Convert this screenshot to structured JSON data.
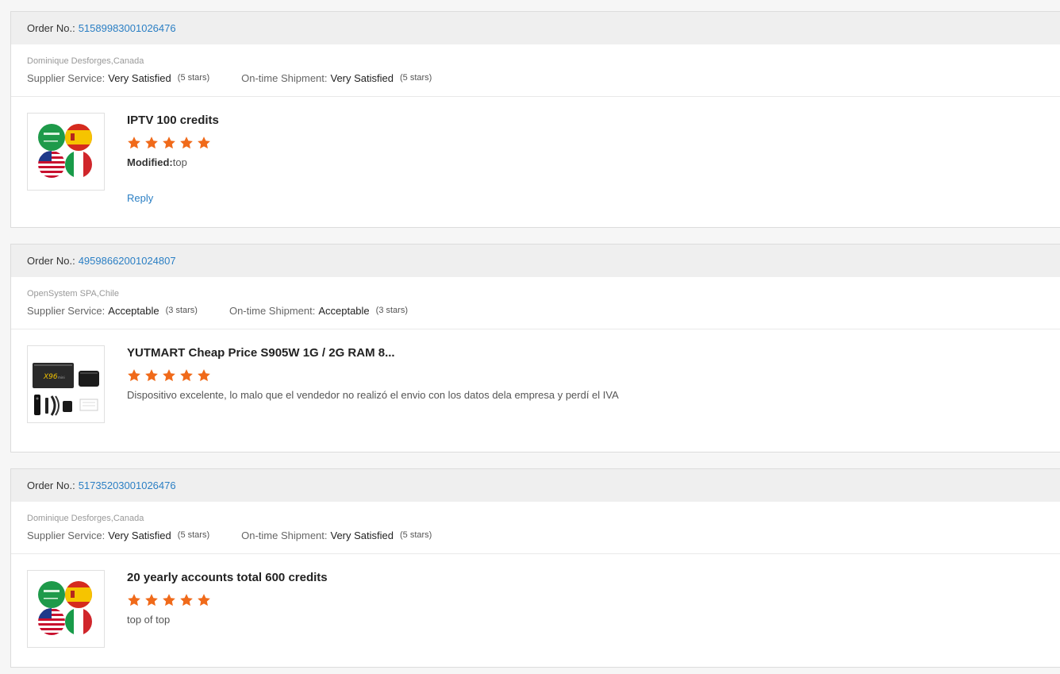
{
  "labels": {
    "order_no": "Order No.:",
    "supplier_service": "Supplier Service:",
    "ontime_shipment": "On-time Shipment:",
    "reply": "Reply"
  },
  "colors": {
    "link": "#2b7fc4",
    "star": "#f06a1a",
    "header_bg": "#efefef"
  },
  "reviews": [
    {
      "order_number": "51589983001026476",
      "buyer": "Dominique Desforges,Canada",
      "supplier_rating": "Very Satisfied",
      "supplier_stars": "(5 stars)",
      "shipment_rating": "Very Satisfied",
      "shipment_stars": "(5 stars)",
      "product_title": "IPTV 100 credits",
      "product_image": "flags-icon",
      "star_count": 5,
      "review_prefix": "Modified:",
      "review_text": "top",
      "reply": "Reply"
    },
    {
      "order_number": "49598662001024807",
      "buyer": "OpenSystem SPA,Chile",
      "supplier_rating": "Acceptable",
      "supplier_stars": "(3 stars)",
      "shipment_rating": "Acceptable",
      "shipment_stars": "(3 stars)",
      "product_title": "YUTMART Cheap Price S905W 1G / 2G RAM 8...",
      "product_image": "tv-box-icon",
      "star_count": 5,
      "review_text": "Dispositivo excelente, lo malo que el vendedor no realizó el envio con los datos dela empresa y perdí el IVA"
    },
    {
      "order_number": "51735203001026476",
      "buyer": "Dominique Desforges,Canada",
      "supplier_rating": "Very Satisfied",
      "supplier_stars": "(5 stars)",
      "shipment_rating": "Very Satisfied",
      "shipment_stars": "(5 stars)",
      "product_title": "20 yearly accounts total 600 credits",
      "product_image": "flags-icon",
      "star_count": 5,
      "review_text": "top of top"
    }
  ]
}
